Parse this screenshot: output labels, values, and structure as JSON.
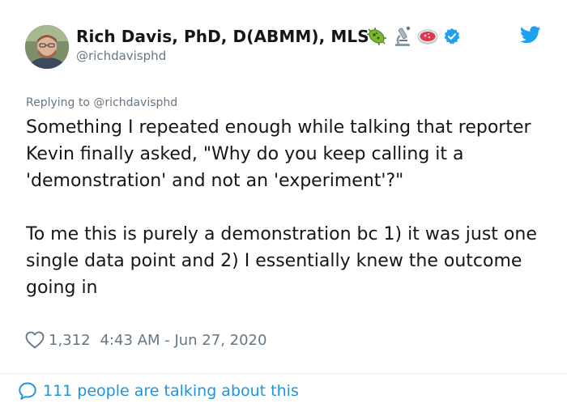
{
  "author": {
    "name": "Rich Davis, PhD, D(ABMM), MLS",
    "handle": "@richdavisphd",
    "badges": [
      "microbe-icon",
      "microscope-icon",
      "petri-dish-icon",
      "verified-icon"
    ]
  },
  "tweet": {
    "replying_to": "Replying to @richdavisphd",
    "paragraph_1": "Something I repeated enough while talking that reporter Kevin finally asked, \"Why do you keep calling it a 'demonstration' and not an 'experiment'?\"",
    "paragraph_2": "To me this is purely a demonstration bc 1) it was just one single data point and 2) I essentially knew the outcome going in",
    "likes": "1,312",
    "timestamp": "4:43 AM - Jun 27, 2020"
  },
  "footer": {
    "talking_label": "111 people are talking about this"
  },
  "colors": {
    "link_blue": "#1b95e0",
    "muted_gray": "#657786",
    "text": "#14171a",
    "verified_blue": "#1da1f2"
  }
}
